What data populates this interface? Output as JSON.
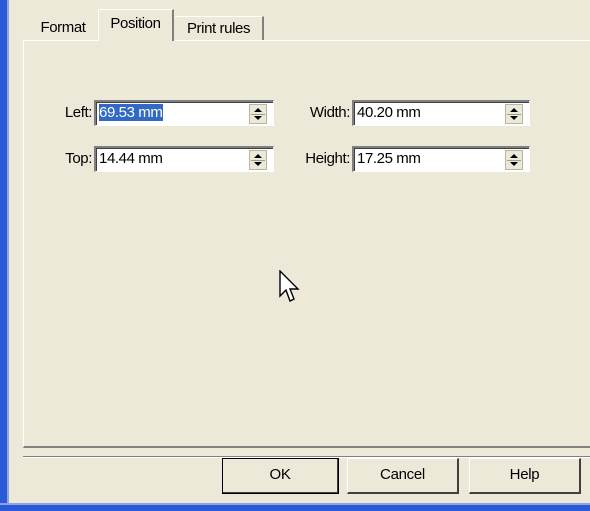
{
  "tabs": [
    {
      "label": "Format"
    },
    {
      "label": "Position"
    },
    {
      "label": "Print rules"
    }
  ],
  "active_tab": "Position",
  "fields": {
    "left": {
      "label": "Left:",
      "value": "69.53 mm"
    },
    "top": {
      "label": "Top:",
      "value": "14.44 mm"
    },
    "width": {
      "label": "Width:",
      "value": "40.20 mm"
    },
    "height": {
      "label": "Height:",
      "value": "17.25 mm"
    }
  },
  "buttons": {
    "ok": "OK",
    "cancel": "Cancel",
    "help": "Help"
  },
  "colors": {
    "dialog_bg": "#ECE9D8",
    "selection": "#316AC5",
    "window_border": "#2B5AD8"
  },
  "icons": {
    "spinner": "spinner-arrows-icon",
    "cursor": "mouse-pointer-icon"
  }
}
